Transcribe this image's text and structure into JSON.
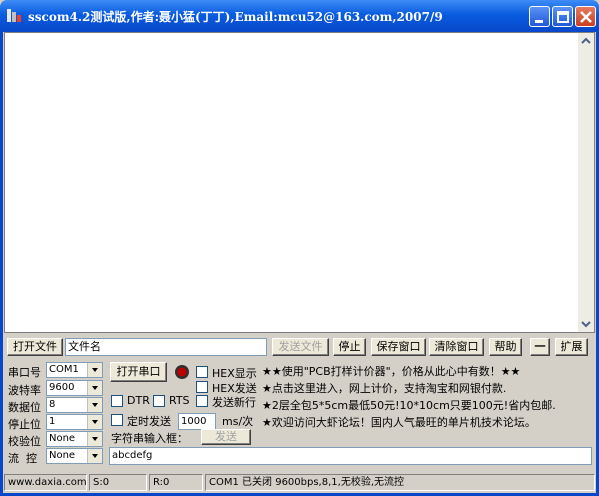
{
  "window": {
    "title": "sscom4.2测试版,作者:聂小猛(丁丁),Email:mcu52@163.com,2007/9"
  },
  "toolbar": {
    "open_file": "打开文件",
    "filename": "文件名",
    "send_file": "发送文件",
    "stop": "停止",
    "save_window": "保存窗口",
    "clear_window": "清除窗口",
    "help": "帮助",
    "minus": "一",
    "expand": "扩展"
  },
  "port": {
    "port_label": "串口号",
    "port_value": "COM1",
    "baud_label": "波特率",
    "baud_value": "9600",
    "databits_label": "数据位",
    "databits_value": "8",
    "stopbits_label": "停止位",
    "stopbits_value": "1",
    "parity_label": "校验位",
    "parity_value": "None",
    "flow_label": "流  控",
    "flow_value": "None"
  },
  "controls": {
    "open_port": "打开串口",
    "hex_display": "HEX显示",
    "hex_send": "HEX发送",
    "dtr": "DTR",
    "rts": "RTS",
    "send_newline": "发送新行",
    "timed_send": "定时发送",
    "interval_value": "1000",
    "interval_unit": "ms/次",
    "input_label": "字符串输入框：",
    "send": "发送",
    "input_value": "abcdefg"
  },
  "ads": [
    "★★使用\"PCB打样计价器\"，价格从此心中有数！★★",
    "★点击这里进入，网上计价，支持淘宝和网银付款.",
    "★2层全包5*5cm最低50元!10*10cm只要100元!省内包邮.",
    "★欢迎访问大虾论坛！国内人气最旺的单片机技术论坛。"
  ],
  "status": {
    "site": "www.daxia.com",
    "sent": "S:0",
    "received": "R:0",
    "port_status": "COM1 已关闭  9600bps,8,1,无校验,无流控"
  },
  "colors": {
    "titlebar": "#0a5ce0",
    "window_bg": "#d4d0c8",
    "indicator": "#c00000"
  }
}
